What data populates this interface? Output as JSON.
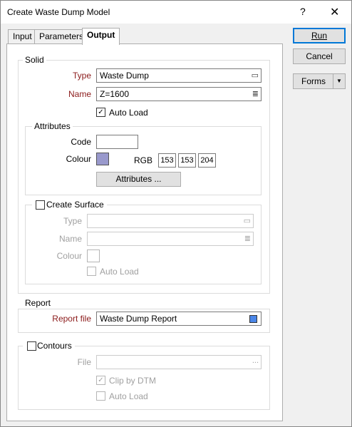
{
  "window": {
    "title": "Create Waste Dump Model",
    "help_glyph": "?",
    "close_glyph": "✕"
  },
  "tabs": [
    {
      "label": "Input"
    },
    {
      "label": "Parameters"
    },
    {
      "label": "Output"
    }
  ],
  "buttons": {
    "run": "Run",
    "cancel": "Cancel",
    "forms": "Forms",
    "forms_arrow": "▼"
  },
  "solid": {
    "group_label": "Solid",
    "type_label": "Type",
    "type_value": "Waste Dump",
    "name_label": "Name",
    "name_value": "Z=1600",
    "auto_load_label": "Auto Load",
    "auto_load_checked": true,
    "attributes": {
      "group_label": "Attributes",
      "code_label": "Code",
      "code_value": "",
      "colour_label": "Colour",
      "colour_hex": "#9999cc",
      "rgb_label": "RGB",
      "r": "153",
      "g": "153",
      "b": "204",
      "button_label": "Attributes ..."
    }
  },
  "create_surface": {
    "label": "Create Surface",
    "checked": false,
    "type_label": "Type",
    "name_label": "Name",
    "colour_label": "Colour",
    "auto_load_label": "Auto Load"
  },
  "report": {
    "group_label": "Report",
    "file_label": "Report file",
    "file_value": "Waste Dump Report",
    "icon_color": "#4a86e8"
  },
  "contours": {
    "label": "Contours",
    "checked": false,
    "file_label": "File",
    "file_browse": "...",
    "clip_label": "Clip by DTM",
    "clip_checked": true,
    "auto_load_label": "Auto Load"
  },
  "icons": {
    "browse": "browse-dots-icon",
    "list": "list-icon",
    "check": "✓"
  }
}
